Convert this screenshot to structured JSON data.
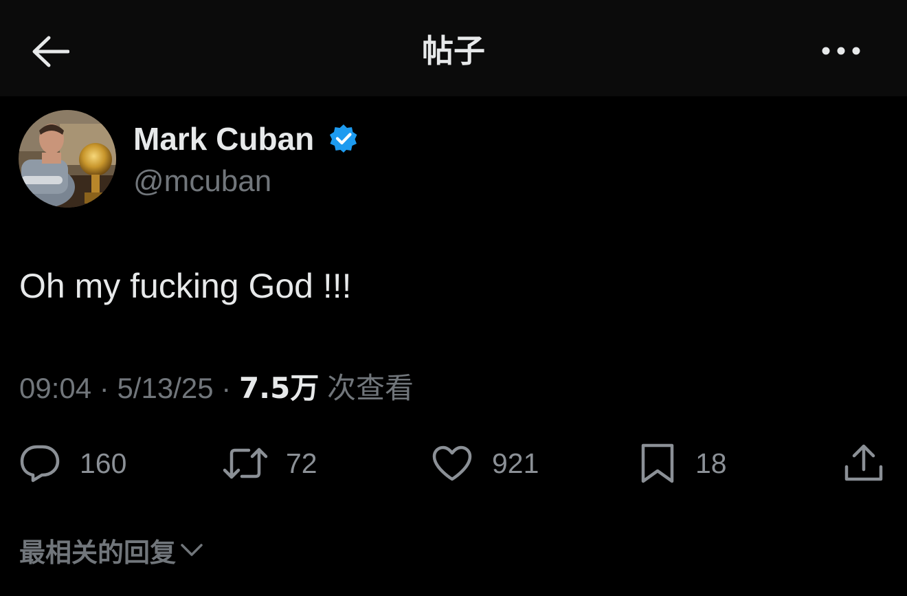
{
  "header": {
    "title": "帖子",
    "back_icon": "arrow-left-icon",
    "more_icon": "more-horizontal-icon"
  },
  "author": {
    "name": "Mark Cuban",
    "handle": "@mcuban",
    "verified": true,
    "verified_color": "#1d9bf0"
  },
  "tweet": {
    "text": "Oh my fucking God !!!",
    "time": "09:04",
    "separator": "·",
    "date": "5/13/25",
    "views_count": "7.5万",
    "views_label": "次查看"
  },
  "actions": [
    {
      "icon": "reply-icon",
      "count": "160"
    },
    {
      "icon": "retweet-icon",
      "count": "72"
    },
    {
      "icon": "heart-icon",
      "count": "921"
    },
    {
      "icon": "bookmark-icon",
      "count": "18"
    },
    {
      "icon": "share-icon",
      "count": ""
    }
  ],
  "replies_sort": {
    "label": "最相关的回复",
    "icon": "chevron-down-icon"
  },
  "colors": {
    "background": "#000000",
    "header_bg": "#0b0b0b",
    "primary_text": "#e7e9ea",
    "secondary_text": "#71767b"
  }
}
